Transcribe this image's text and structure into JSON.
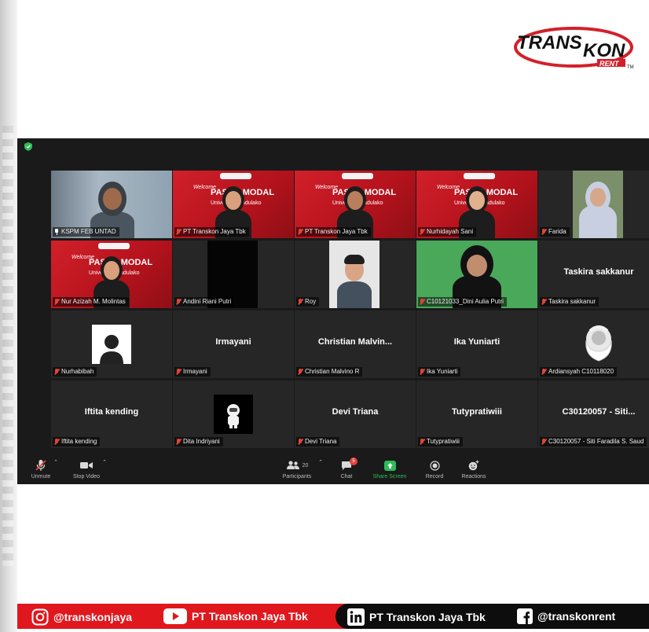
{
  "brand": {
    "line1": "TRANS",
    "line2": "KON",
    "line3": "RENT",
    "tm": "TM",
    "accent": "#d2202a"
  },
  "banner": {
    "welcome": "Welcome",
    "title": "PASAR MODAL",
    "subtitle": "Universitas Tadulako"
  },
  "tiles": [
    {
      "row": 0,
      "col": 0,
      "name": "KSPM FEB UNTAD",
      "kind": "video-room",
      "pinned": true,
      "active": true
    },
    {
      "row": 0,
      "col": 1,
      "name": "PT Transkon Jaya Tbk",
      "kind": "video-banner",
      "muted": true
    },
    {
      "row": 0,
      "col": 2,
      "name": "PT Transkon Jaya Tbk",
      "kind": "video-banner",
      "muted": true
    },
    {
      "row": 0,
      "col": 3,
      "name": "Nurhidayah Sani",
      "kind": "video-banner",
      "muted": true
    },
    {
      "row": 0,
      "col": 4,
      "name": "Farida",
      "kind": "video-hijab",
      "muted": true
    },
    {
      "row": 1,
      "col": 0,
      "name": "Nur Azizah M. Molintas",
      "kind": "video-banner",
      "muted": true
    },
    {
      "row": 1,
      "col": 1,
      "name": "Andini Riani Putri",
      "kind": "video-black",
      "muted": true
    },
    {
      "row": 1,
      "col": 2,
      "name": "Roy",
      "kind": "video-man",
      "muted": true
    },
    {
      "row": 1,
      "col": 3,
      "name": "C10121033_Dini Aulia Putri",
      "kind": "video-green",
      "muted": true
    },
    {
      "row": 1,
      "col": 4,
      "name": "Taskira sakkanur",
      "display": "Taskira sakkanur",
      "kind": "name-only",
      "muted": true
    },
    {
      "row": 2,
      "col": 0,
      "name": "Nurhabibah",
      "kind": "avatar-silhouette",
      "muted": true
    },
    {
      "row": 2,
      "col": 1,
      "name": "Irmayani",
      "display": "Irmayani",
      "kind": "name-only",
      "muted": true
    },
    {
      "row": 2,
      "col": 2,
      "name": "Christian Malvino R",
      "display": "Christian  Malvin...",
      "kind": "name-only",
      "muted": true
    },
    {
      "row": 2,
      "col": 3,
      "name": "Ika Yuniarti",
      "display": "Ika Yuniarti",
      "kind": "name-only",
      "muted": true
    },
    {
      "row": 2,
      "col": 4,
      "name": "Ardiansyah C10118020",
      "kind": "avatar-portrait",
      "muted": true
    },
    {
      "row": 3,
      "col": 0,
      "name": "Iftita kending",
      "display": "Iftita kending",
      "kind": "name-only",
      "muted": true
    },
    {
      "row": 3,
      "col": 1,
      "name": "Dita Indriyani",
      "kind": "avatar-astronaut",
      "muted": true
    },
    {
      "row": 3,
      "col": 2,
      "name": "Devi Triana",
      "display": "Devi Triana",
      "kind": "name-only",
      "muted": true
    },
    {
      "row": 3,
      "col": 3,
      "name": "Tutypratiwiii",
      "display": "Tutypratiwiii",
      "kind": "name-only",
      "muted": true
    },
    {
      "row": 3,
      "col": 4,
      "name": "C30120057 - Siti Faradila S. Saud",
      "display": "C30120057 - Siti...",
      "kind": "name-only",
      "muted": true
    }
  ],
  "toolbar": {
    "unmute": "Unmute",
    "stop_video": "Stop Video",
    "participants": "Participants",
    "participants_count": "20",
    "chat": "Chat",
    "chat_badge": "5",
    "share_screen": "Share Screen",
    "record": "Record",
    "reactions": "Reactions",
    "share_color": "#2dbd57"
  },
  "social": {
    "instagram": "@transkonjaya",
    "youtube": "PT Transkon Jaya Tbk",
    "linkedin": "PT Transkon Jaya Tbk",
    "facebook": "@transkonrent"
  }
}
